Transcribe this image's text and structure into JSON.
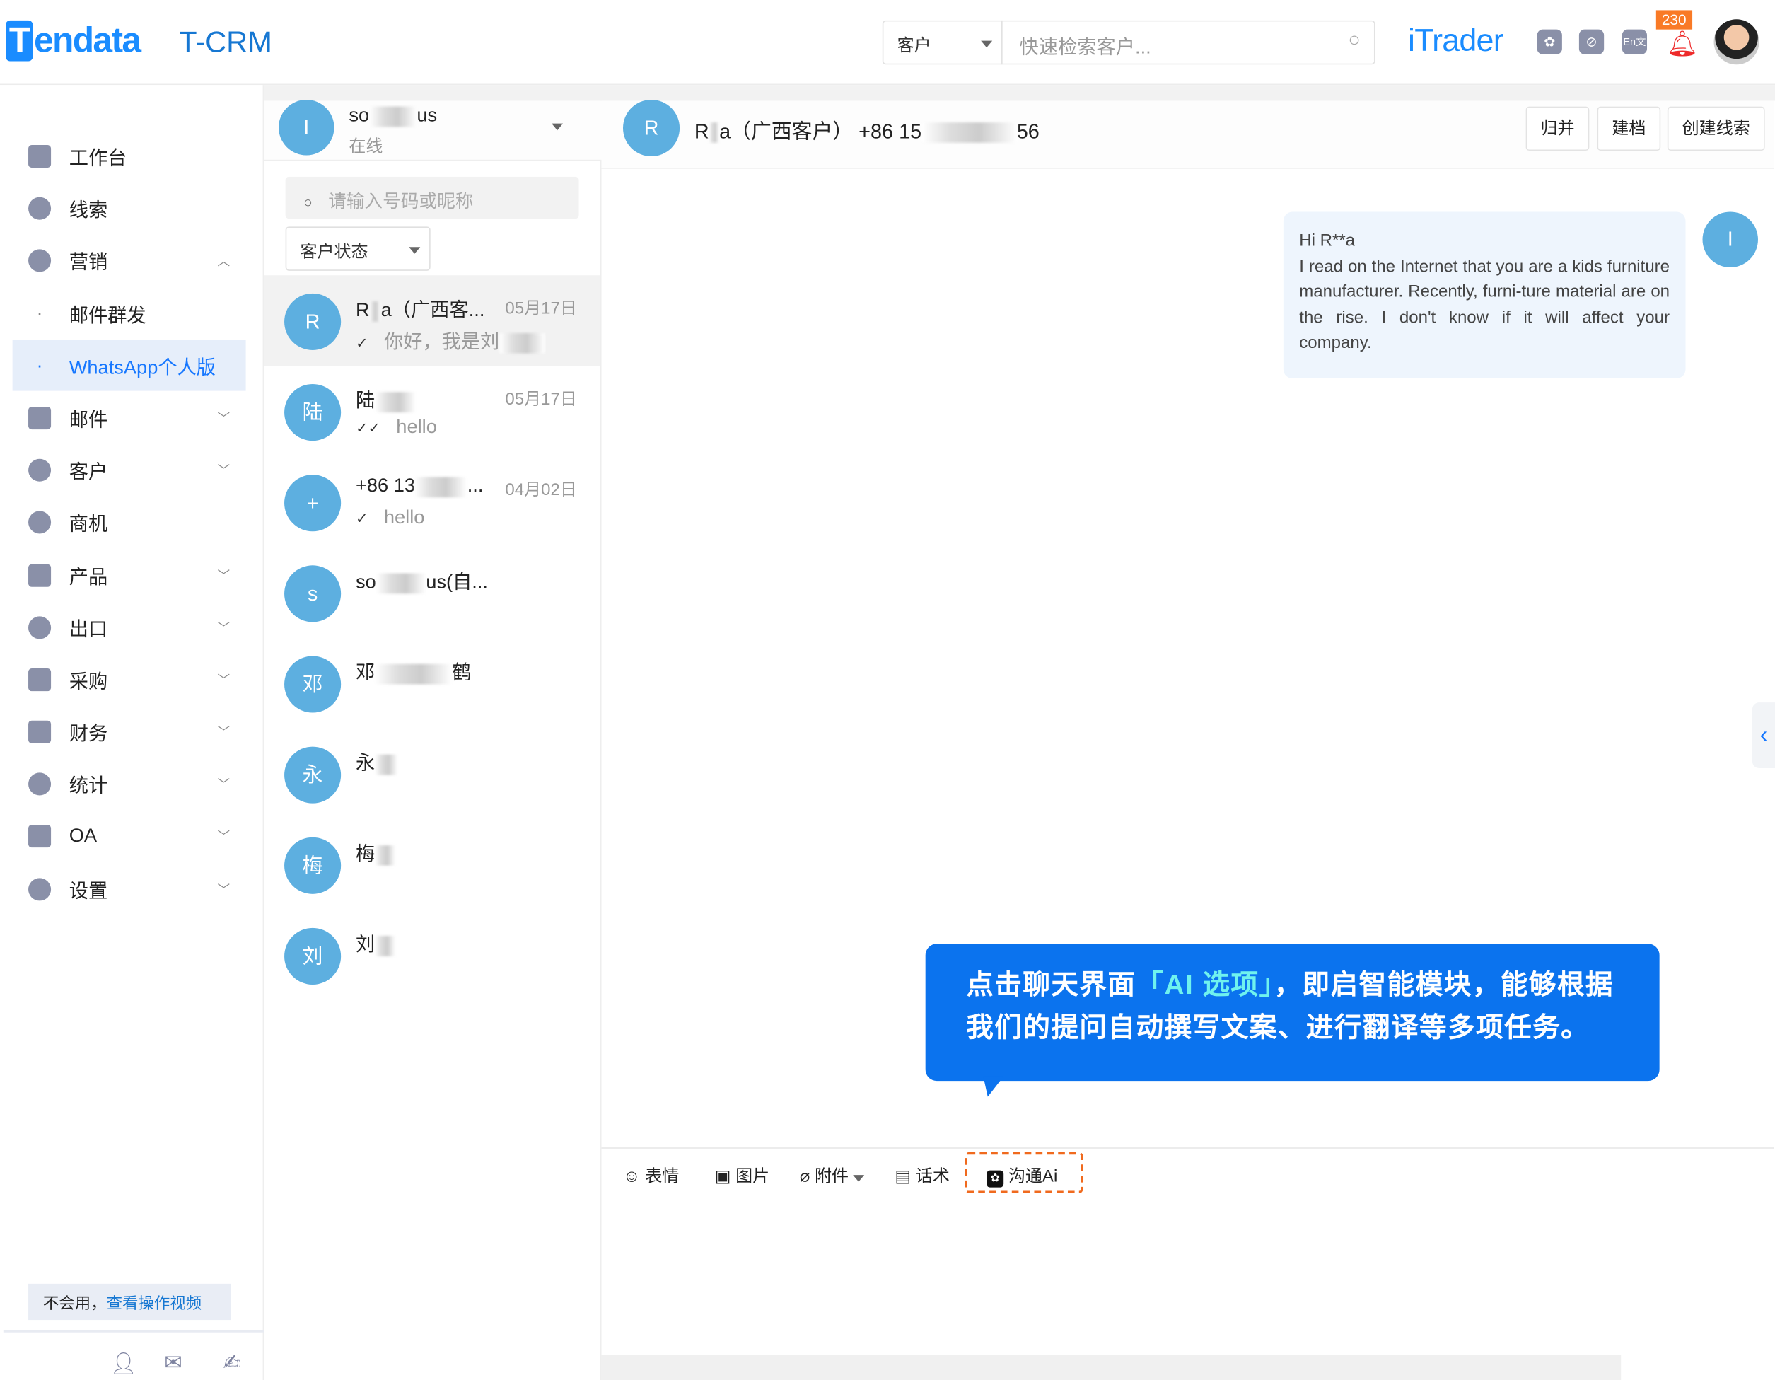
{
  "header": {
    "logo_text": "Tendata",
    "product": "T-CRM",
    "search_scope": "客户",
    "search_placeholder": "快速检索客户...",
    "brand": "iTrader",
    "notification_count": "230",
    "icons": [
      "chatgpt-icon",
      "link-icon",
      "translate-icon",
      "bell-icon",
      "user-avatar"
    ]
  },
  "sidebar": {
    "items": [
      {
        "label": "工作台",
        "icon": "dashboard-icon"
      },
      {
        "label": "线索",
        "icon": "leads-icon"
      },
      {
        "label": "营销",
        "icon": "marketing-icon",
        "expanded": true
      },
      {
        "label": "邮件群发",
        "sub": true
      },
      {
        "label": "WhatsApp个人版",
        "sub": true,
        "active": true
      },
      {
        "label": "邮件",
        "icon": "mail-icon"
      },
      {
        "label": "客户",
        "icon": "customers-icon"
      },
      {
        "label": "商机",
        "icon": "dollar-icon"
      },
      {
        "label": "产品",
        "icon": "box-icon"
      },
      {
        "label": "出口",
        "icon": "globe-icon"
      },
      {
        "label": "采购",
        "icon": "cart-icon"
      },
      {
        "label": "财务",
        "icon": "finance-icon"
      },
      {
        "label": "统计",
        "icon": "pie-icon"
      },
      {
        "label": "OA",
        "icon": "oa-icon"
      },
      {
        "label": "设置",
        "icon": "gear-icon"
      }
    ],
    "help_prefix": "不会用，",
    "help_link": "查看操作视频"
  },
  "account": {
    "avatar": "I",
    "name": "so",
    "name_suffix": "us",
    "status": "在线"
  },
  "contacts": {
    "search_placeholder": "请输入号码或昵称",
    "status_filter": "客户状态",
    "items": [
      {
        "avatar": "R",
        "name": "R",
        "name_rest": "a（广西客...",
        "date": "05月17日",
        "check": "✓",
        "preview": "你好，我是刘"
      },
      {
        "avatar": "陆",
        "name": "陆",
        "date": "05月17日",
        "check": "✓✓",
        "preview": "hello"
      },
      {
        "avatar": "+",
        "name": "+86 13",
        "name_rest": "...",
        "date": "04月02日",
        "check": "✓",
        "preview": "hello"
      },
      {
        "avatar": "s",
        "name": "so",
        "name_rest": "us(自..."
      },
      {
        "avatar": "邓",
        "name": "邓",
        "name_rest": "鹤"
      },
      {
        "avatar": "永",
        "name": "永"
      },
      {
        "avatar": "梅",
        "name": "梅"
      },
      {
        "avatar": "刘",
        "name": "刘"
      }
    ]
  },
  "chat": {
    "avatar": "R",
    "title_a": "R",
    "title_b": "a（广西客户） +86 15",
    "title_c": "56",
    "buttons": {
      "merge": "归并",
      "archive": "建档",
      "create_lead": "创建线索"
    },
    "message": {
      "greeting": "Hi R**a",
      "body": "I read on the Internet that you are a kids furniture manufacturer. Recently, furni-ture material are on the rise. I don't know if it will affect your company.",
      "avatar": "I"
    },
    "toolbar": {
      "emoji": "表情",
      "image": "图片",
      "attachment": "附件",
      "script": "话术",
      "ai": "沟通Ai"
    },
    "tooltip": {
      "line1_a": "点击聊天界面",
      "line1_hl": "「AI 选项」",
      "line1_b": "，即启智能模块，能够根据",
      "line2": "我们的提问自动撰写文案、进行翻译等多项任务。"
    },
    "accent": "#0b73ee",
    "highlight_border": "#f06a1e"
  }
}
